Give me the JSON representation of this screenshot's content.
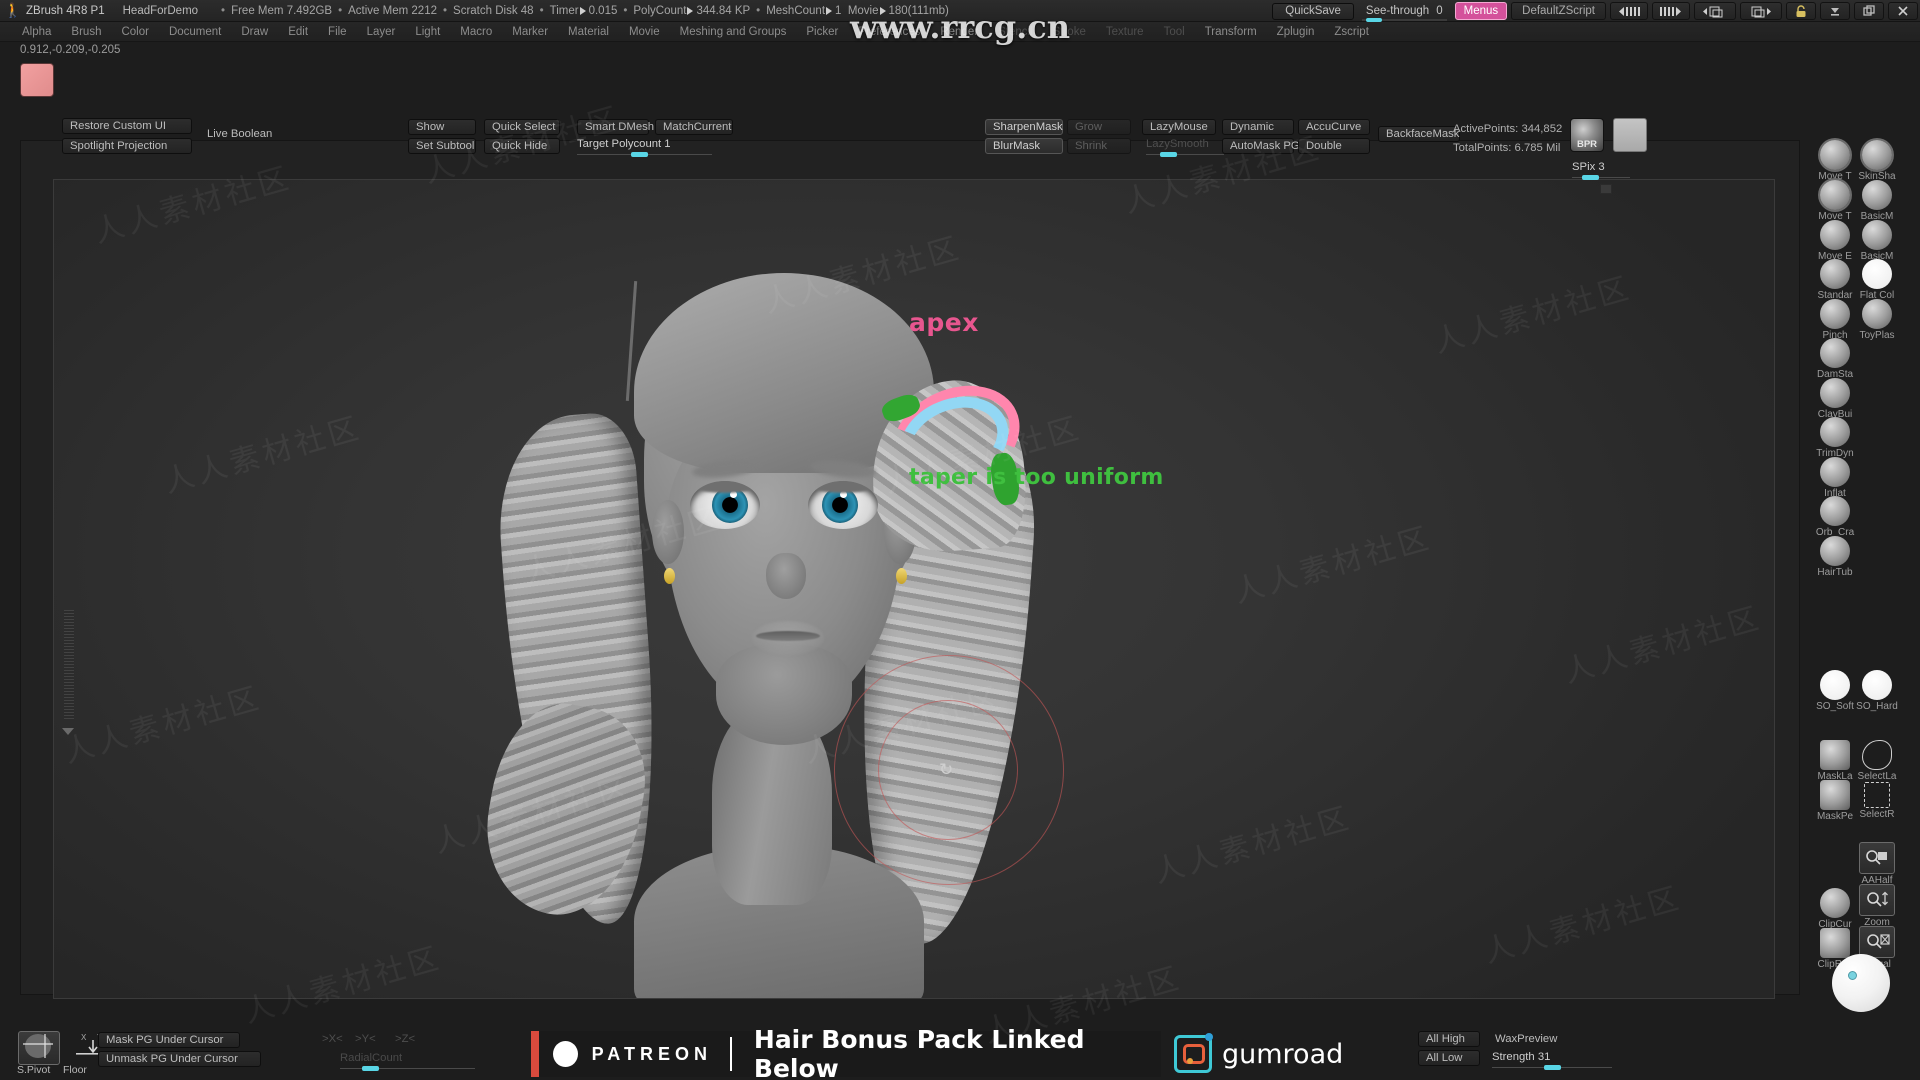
{
  "titlebar": {
    "app_title": "ZBrush 4R8 P1",
    "document": "HeadForDemo",
    "stats": [
      {
        "label": "Free Mem",
        "value": "7.492GB",
        "arrow": false
      },
      {
        "label": "Active Mem",
        "value": "2212",
        "arrow": false
      },
      {
        "label": "Scratch Disk",
        "value": "48",
        "arrow": false
      },
      {
        "label": "Timer",
        "value": "0.015",
        "arrow": true
      },
      {
        "label": "PolyCount",
        "value": "344.84 KP",
        "arrow": true
      },
      {
        "label": "MeshCount",
        "value": "1",
        "arrow": true
      },
      {
        "label": "Movie",
        "value": "180(111mb)",
        "arrow": true
      }
    ],
    "quicksave_label": "QuickSave",
    "seethrough_label": "See-through",
    "seethrough_value": "0",
    "menus_label": "Menus",
    "zscript_label": "DefaultZScript",
    "watermark_center": "www.rrcg.cn"
  },
  "menubar": {
    "items": [
      "Alpha",
      "Brush",
      "Color",
      "Document",
      "Draw",
      "Edit",
      "File",
      "Layer",
      "Light",
      "Macro",
      "Marker",
      "Material",
      "Movie",
      "Meshing and Groups",
      "Picker",
      "Preferences",
      "Render",
      "Stencil",
      "Stroke",
      "Texture",
      "Tool",
      "Transform",
      "Zplugin",
      "Zscript"
    ]
  },
  "coords": "0.912,-0.209,-0.205",
  "shelf": {
    "restore_ui": "Restore Custom UI",
    "spotlight_projection": "Spotlight Projection",
    "live_boolean": "Live Boolean",
    "show": "Show",
    "set_subtool": "Set Subtool",
    "quick_select": "Quick Select",
    "quick_hide": "Quick Hide",
    "smart_dmesh": "Smart DMesh",
    "match_current": "MatchCurrent",
    "target_polycount_label": "Target Polycount",
    "target_polycount_value": "1",
    "sharpen_mask": "SharpenMask",
    "blur_mask": "BlurMask",
    "grow": "Grow",
    "shrink": "Shrink",
    "lazy_mouse": "LazyMouse",
    "lazy_smooth": "LazySmooth",
    "dynamic": "Dynamic",
    "automask_pg": "AutoMask PG",
    "accucurve": "AccuCurve",
    "double": "Double",
    "backface_mask": "BackfaceMask",
    "active_points": "ActivePoints: 344,852",
    "total_points": "TotalPoints: 6.785 Mil",
    "bpr_label": "BPR",
    "spix_label": "SPix",
    "spix_value": "3"
  },
  "canvas": {
    "annotation_apex": "apex",
    "annotation_taper": "taper is too uniform",
    "apex_color": "#e8568f",
    "taper_color": "#3fbf3f",
    "cursor_glyph": "↻"
  },
  "right_rail": {
    "brushes": [
      {
        "label": "Move T",
        "col": 0,
        "selected": true
      },
      {
        "label": "SkinSha",
        "col": 1,
        "selected": true
      },
      {
        "label": "Move T",
        "col": 0,
        "selected": true
      },
      {
        "label": "BasicM",
        "col": 1,
        "selected": false
      },
      {
        "label": "Move E",
        "col": 0,
        "selected": false
      },
      {
        "label": "BasicM",
        "col": 1,
        "selected": false
      },
      {
        "label": "Standar",
        "col": 0,
        "selected": false
      },
      {
        "label": "Flat Col",
        "col": 1,
        "selected": false
      },
      {
        "label": "Pinch",
        "col": 0,
        "selected": false
      },
      {
        "label": "ToyPlas",
        "col": 1,
        "selected": false
      },
      {
        "label": "DamSta",
        "col": 0,
        "selected": false
      },
      {
        "label": "ClayBui",
        "col": 0,
        "selected": false
      },
      {
        "label": "TrimDyn",
        "col": 0,
        "selected": false
      },
      {
        "label": "Inflat",
        "col": 0,
        "selected": false
      },
      {
        "label": "Orb_Cra",
        "col": 0,
        "selected": false
      },
      {
        "label": "HairTub",
        "col": 0,
        "selected": false
      }
    ],
    "strokes": [
      {
        "label": "SO_Soft",
        "col": 0
      },
      {
        "label": "SO_Hard",
        "col": 1
      }
    ],
    "masks": [
      {
        "label": "MaskLa",
        "col": 0
      },
      {
        "label": "SelectLa",
        "col": 1
      },
      {
        "label": "MaskPe",
        "col": 0
      },
      {
        "label": "SelectR",
        "col": 1
      }
    ],
    "view_buttons": [
      {
        "label": "AAHalf"
      },
      {
        "label": "Zoom"
      },
      {
        "label": "Actual"
      }
    ],
    "clip_brushes": [
      {
        "label": "ClipCur"
      },
      {
        "label": "ClipRec"
      }
    ]
  },
  "bottom": {
    "s_pivot": "S.Pivot",
    "floor": "Floor",
    "mask_pg": "Mask PG Under Cursor",
    "unmask_pg": "Unmask PG Under Cursor",
    "axis_x": ">X<",
    "axis_y": ">Y<",
    "axis_z": ">Z<",
    "radial_count_label": "RadialCount",
    "all_high": "All High",
    "all_low": "All Low",
    "wax_preview": "WaxPreview",
    "strength_label": "Strength",
    "strength_value": "31",
    "banner": {
      "patreon": "PATREON",
      "message": "Hair Bonus Pack Linked Below",
      "gumroad": "gumroad"
    }
  }
}
